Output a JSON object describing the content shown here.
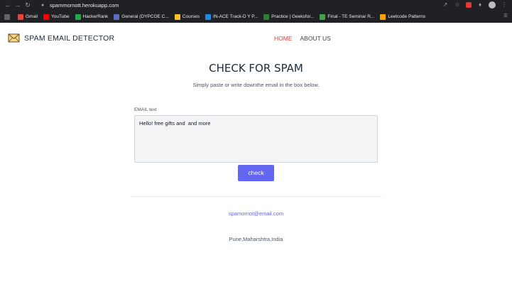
{
  "browser": {
    "url": "spammornott.herokuapp.com",
    "bookmarks": [
      {
        "label": "Gmail",
        "color": "#ea4335"
      },
      {
        "label": "YouTube",
        "color": "#ff0000"
      },
      {
        "label": "HackerRank",
        "color": "#1ba94c"
      },
      {
        "label": "General (DYPCOE C...",
        "color": "#5c6bc0"
      },
      {
        "label": "Courses",
        "color": "#fbc02d"
      },
      {
        "label": "IN-ACE Track-D Y P...",
        "color": "#1e88e5"
      },
      {
        "label": "Practice | Geeksfor...",
        "color": "#2e7d32"
      },
      {
        "label": "Final - TE Seminar R...",
        "color": "#43a047"
      },
      {
        "label": "Leetcode Patterns",
        "color": "#ffa000"
      }
    ]
  },
  "header": {
    "brand": "SPAM EMAIL DETECTOR",
    "nav": {
      "home": "HOME",
      "about": "ABOUT US"
    }
  },
  "main": {
    "title": "CHECK FOR SPAM",
    "subtitle": "Simply paste or write downthe email in the box below.",
    "field_label": "EMAIL text",
    "field_value": "Hello! free gifts and  and more",
    "button_label": "check"
  },
  "footer": {
    "email": "spamornot@email.com",
    "address": "Pune,Maharshtra,India"
  },
  "colors": {
    "accent": "#6366f1",
    "nav_active": "#e53935"
  }
}
